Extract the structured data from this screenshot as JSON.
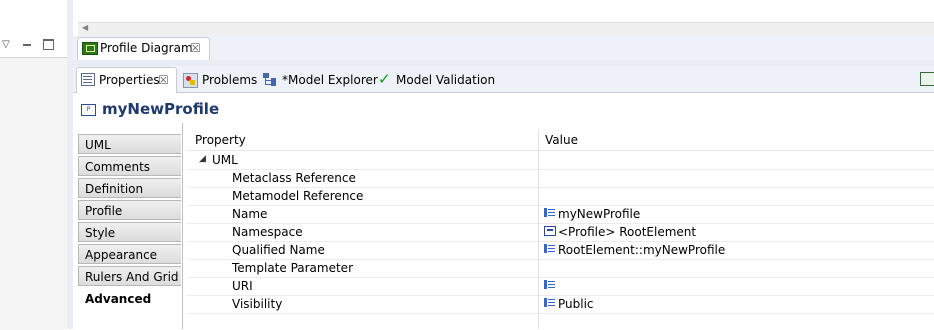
{
  "left_view": {
    "icons": [
      "view-menu-icon",
      "minimize-icon",
      "maximize-icon"
    ]
  },
  "editor": {
    "tab_label": "Profile Diagram",
    "close_glyph": "☒"
  },
  "views": {
    "tabs": [
      {
        "label": "Properties",
        "icon": "properties-icon"
      },
      {
        "label": "Problems",
        "icon": "problems-icon"
      },
      {
        "label": "*Model Explorer",
        "icon": "model-explorer-icon"
      },
      {
        "label": "Model Validation",
        "icon": "check-icon"
      }
    ],
    "close_glyph": "☒"
  },
  "properties": {
    "title": "myNewProfile",
    "categories": [
      "UML",
      "Comments",
      "Definition",
      "Profile",
      "Style",
      "Appearance",
      "Rulers And Grid",
      "Advanced"
    ],
    "active_category": "Advanced",
    "table": {
      "col_property": "Property",
      "col_value": "Value",
      "group": "UML",
      "rows": [
        {
          "name": "Metaclass Reference",
          "value": ""
        },
        {
          "name": "Metamodel Reference",
          "value": ""
        },
        {
          "name": "Name",
          "value": "myNewProfile"
        },
        {
          "name": "Namespace",
          "value": "<Profile> RootElement"
        },
        {
          "name": "Qualified Name",
          "value": "RootElement::myNewProfile"
        },
        {
          "name": "Template Parameter",
          "value": ""
        },
        {
          "name": "URI",
          "value": ""
        },
        {
          "name": "Visibility",
          "value": "Public"
        }
      ]
    }
  },
  "colors": {
    "title": "#1f3a6b",
    "tabbar": "#eef2f8",
    "check": "#0a9a1a"
  }
}
